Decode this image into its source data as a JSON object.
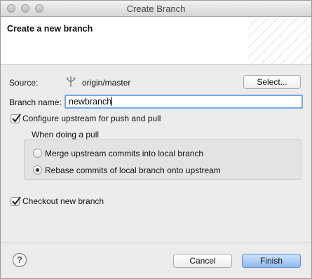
{
  "window": {
    "title": "Create Branch"
  },
  "header": {
    "title": "Create a new branch"
  },
  "source": {
    "label": "Source:",
    "value": "origin/master",
    "icon": "branch-icon",
    "select_label": "Select..."
  },
  "branch_name": {
    "label": "Branch name:",
    "value": "newbranch"
  },
  "configure_upstream": {
    "label": "Configure upstream for push and pull",
    "checked": true
  },
  "pull_group": {
    "title": "When doing a pull",
    "options": [
      {
        "label": "Merge upstream commits into local branch",
        "selected": false
      },
      {
        "label": "Rebase commits of local branch onto upstream",
        "selected": true
      }
    ]
  },
  "checkout": {
    "label": "Checkout new branch",
    "checked": true
  },
  "footer": {
    "help_label": "?",
    "cancel_label": "Cancel",
    "finish_label": "Finish"
  },
  "colors": {
    "accent": "#7aa7e6",
    "primary_button": "#8fbaf0",
    "traffic_light": "#c6c6c6"
  }
}
